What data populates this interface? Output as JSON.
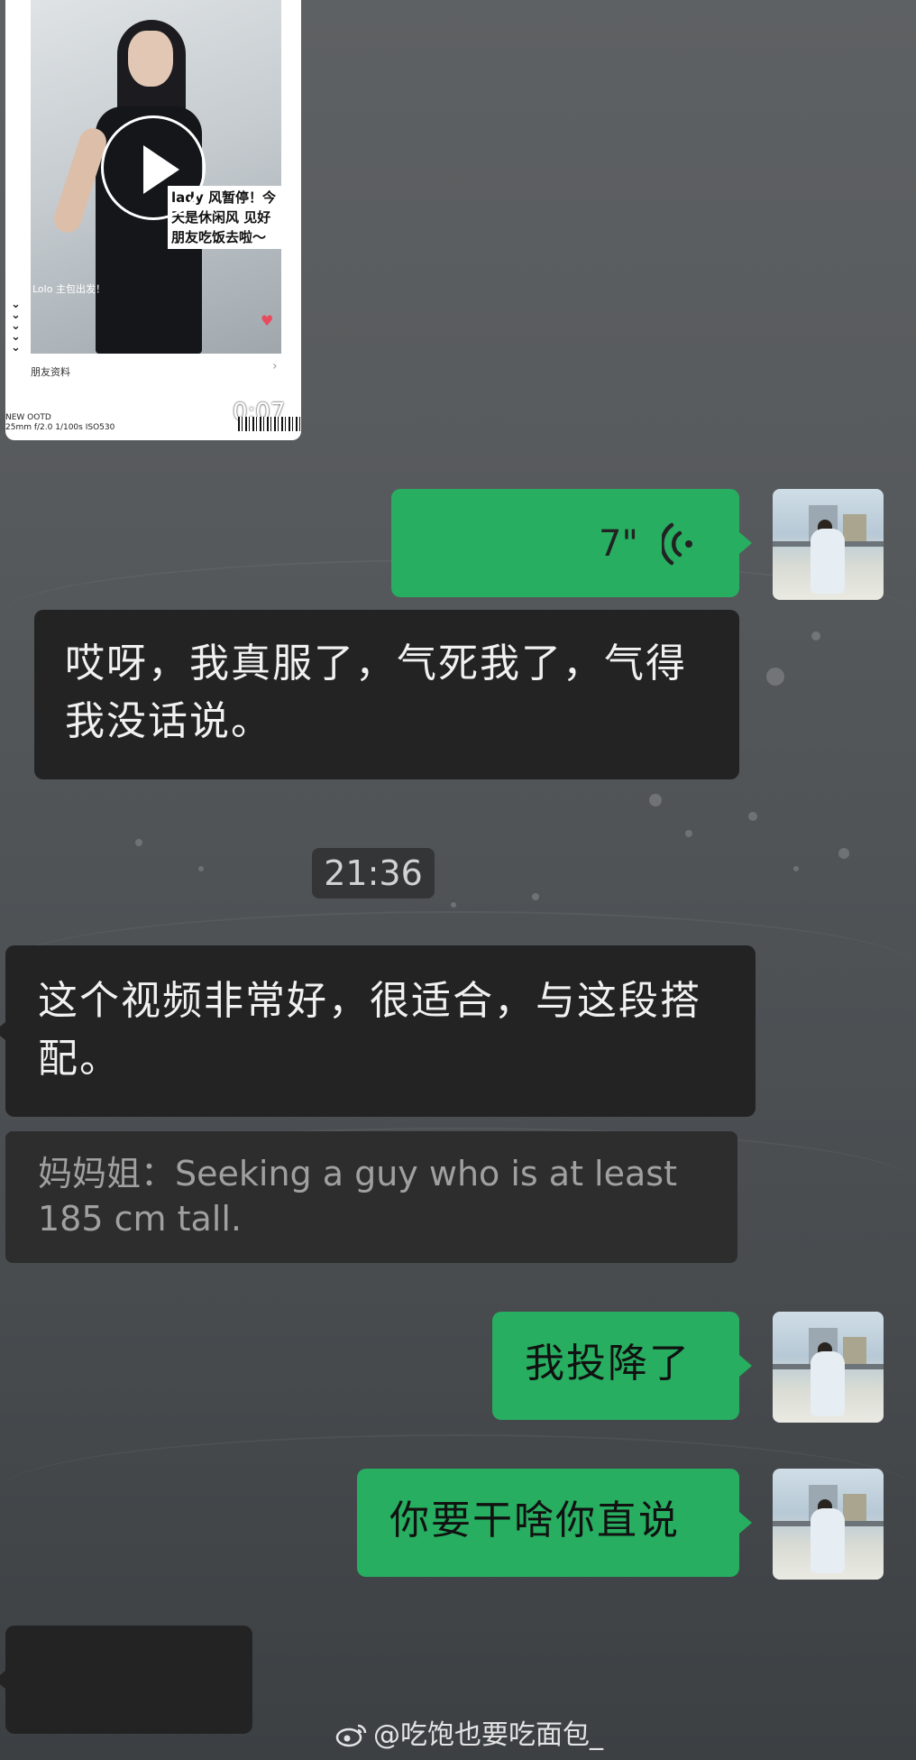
{
  "video": {
    "caption": "lady 风暂停！今天是休闲风 见好朋友吃饭去啦～",
    "tag": "Lolo 主包出发！",
    "friend_info": "朋友资料",
    "ootd_line1": "NEW OOTD",
    "ootd_line2": "25mm f/2.0 1/100s ISO530",
    "duration": "0:07"
  },
  "voice_message": {
    "duration": "7\""
  },
  "messages": {
    "received_1": "哎呀，我真服了，气死我了，气得我没话说。",
    "timestamp": "21:36",
    "received_2": "这个视频非常好，很适合，与这段搭配。",
    "quote": "妈妈姐：Seeking a guy who is at least 185 cm tall.",
    "sent_1": "我投降了",
    "sent_2": "你要干啥你直说"
  },
  "watermark": "@吃饱也要吃面包_",
  "colors": {
    "sent_bubble": "#27ae60",
    "received_bubble": "#232323"
  }
}
